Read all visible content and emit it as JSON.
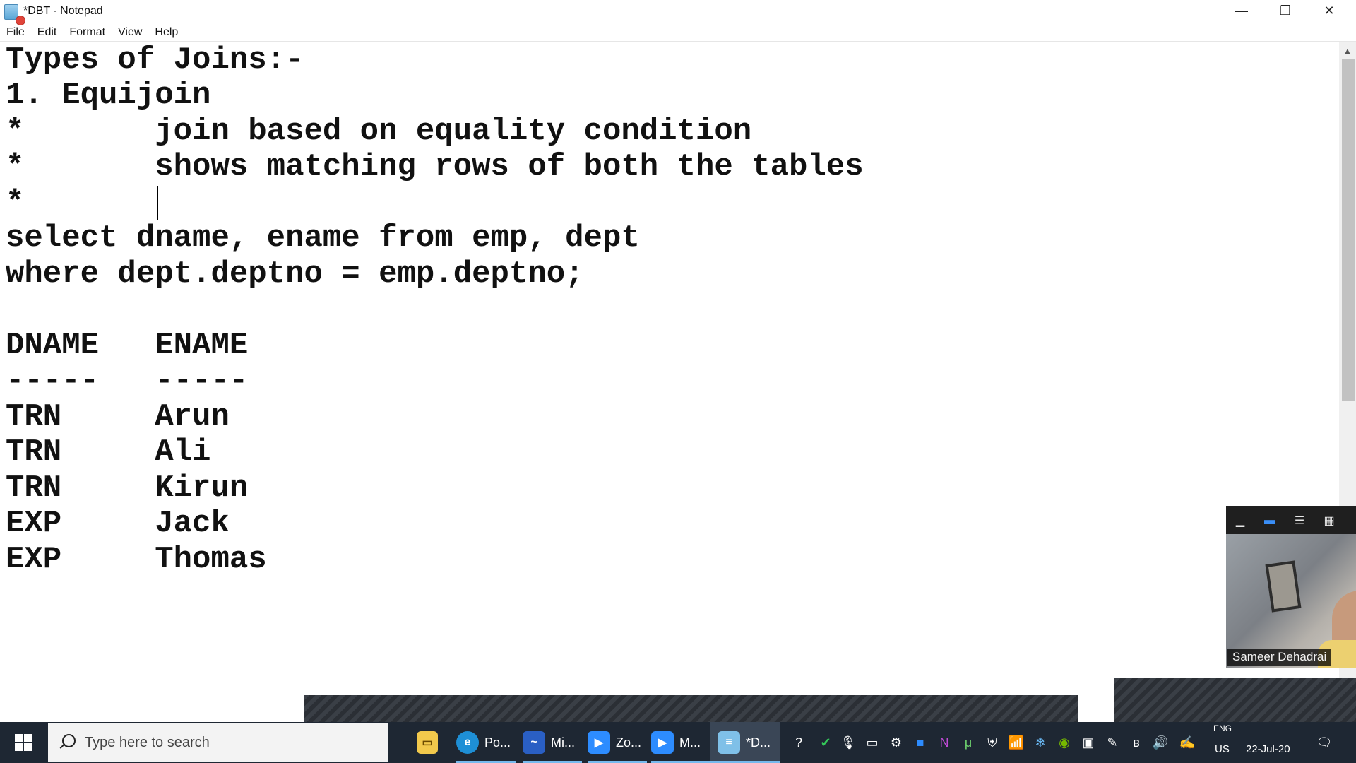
{
  "window": {
    "title": "*DBT - Notepad",
    "controls": {
      "minimize": "—",
      "restore": "❐",
      "close": "✕"
    }
  },
  "menu": [
    "File",
    "Edit",
    "Format",
    "View",
    "Help"
  ],
  "editor": {
    "lines": [
      "Types of Joins:-",
      "1. Equijoin",
      "*       join based on equality condition",
      "*       shows matching rows of both the tables",
      "*",
      "select dname, ename from emp, dept",
      "where dept.deptno = emp.deptno;",
      "",
      "DNAME   ENAME",
      "-----   -----",
      "TRN     Arun",
      "TRN     Ali",
      "TRN     Kirun",
      "EXP     Jack",
      "EXP     Thomas"
    ]
  },
  "zoom": {
    "participant_name": "Sameer Dehadrai"
  },
  "taskbar": {
    "search_placeholder": "Type here to search",
    "apps": [
      {
        "icon": "file-explorer-icon",
        "label": ""
      },
      {
        "icon": "edge-icon",
        "label": "Po..."
      },
      {
        "icon": "whiteboard-icon",
        "label": "Mi..."
      },
      {
        "icon": "zoom-icon",
        "label": "Zo..."
      },
      {
        "icon": "zoom-meeting-icon",
        "label": "M..."
      },
      {
        "icon": "notepad-icon",
        "label": "*D..."
      }
    ],
    "language_top": "ENG",
    "language_bottom": "US",
    "date": "22-Jul-20",
    "colors": {
      "taskbar": "#1e2733",
      "accent": "#76b9ed"
    }
  }
}
